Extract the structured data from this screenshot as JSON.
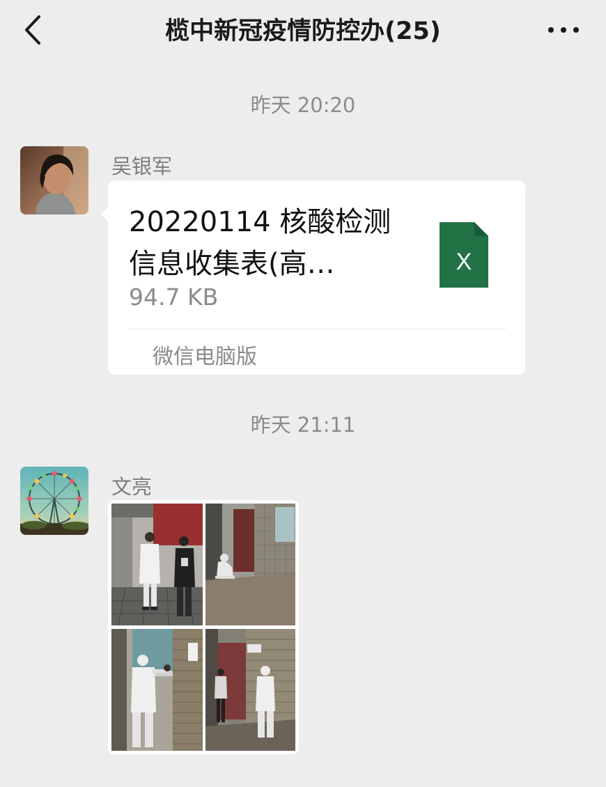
{
  "header": {
    "title": "榄中新冠疫情防控办(25)"
  },
  "messages": [
    {
      "timestamp": "昨天 20:20",
      "sender": "吴银军",
      "file": {
        "name_line1": "20220114 核酸检测",
        "name_line2": "信息收集表(高…",
        "size": "94.7 KB",
        "icon_label": "X",
        "icon_color": "#217346",
        "source": "微信电脑版"
      }
    },
    {
      "timestamp": "昨天 21:11",
      "sender": "文亮",
      "photo_count": 4
    }
  ]
}
